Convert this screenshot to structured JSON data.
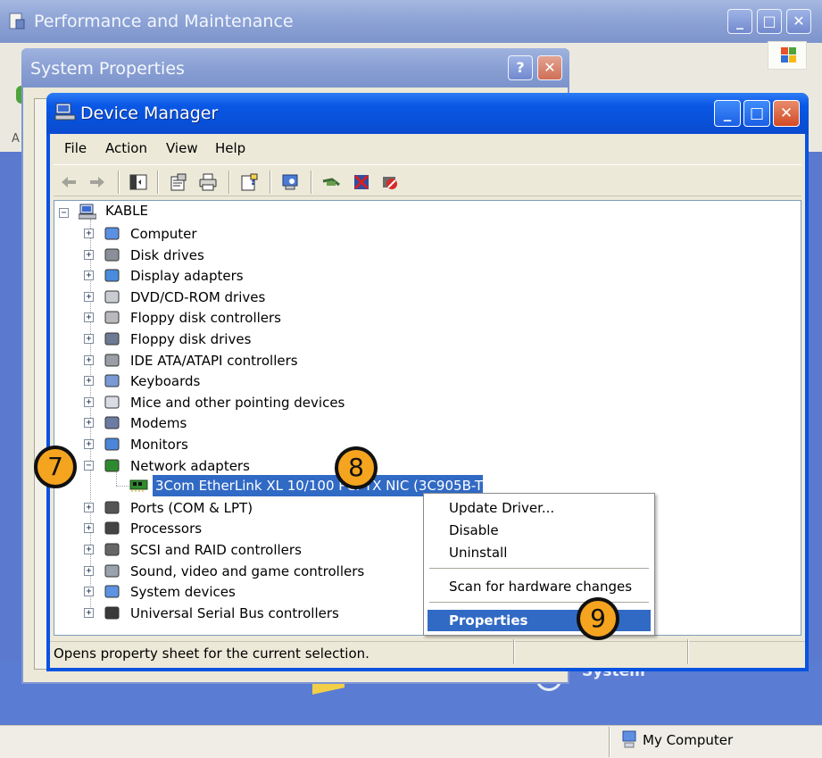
{
  "background_window": {
    "title": "Performance and Maintenance",
    "system_label": "System",
    "status_item": "My Computer",
    "menu_letter": "A"
  },
  "system_properties": {
    "title": "System Properties",
    "help_button": "?",
    "close_button": "✕"
  },
  "device_manager": {
    "title": "Device Manager",
    "menu": [
      "File",
      "Action",
      "View",
      "Help"
    ],
    "toolbar": [
      "back-icon",
      "forward-icon",
      "show-hide-console-tree-icon",
      "properties-icon",
      "print-icon",
      "help-icon",
      "scan-hardware-icon",
      "update-driver-icon",
      "uninstall-icon",
      "disable-icon"
    ],
    "tree": {
      "root": "KABLE",
      "categories": [
        {
          "label": "Computer",
          "expanded": false
        },
        {
          "label": "Disk drives",
          "expanded": false
        },
        {
          "label": "Display adapters",
          "expanded": false
        },
        {
          "label": "DVD/CD-ROM drives",
          "expanded": false
        },
        {
          "label": "Floppy disk controllers",
          "expanded": false
        },
        {
          "label": "Floppy disk drives",
          "expanded": false
        },
        {
          "label": "IDE ATA/ATAPI controllers",
          "expanded": false
        },
        {
          "label": "Keyboards",
          "expanded": false
        },
        {
          "label": "Mice and other pointing devices",
          "expanded": false
        },
        {
          "label": "Modems",
          "expanded": false
        },
        {
          "label": "Monitors",
          "expanded": false
        },
        {
          "label": "Network adapters",
          "expanded": true
        },
        {
          "label": "Ports (COM & LPT)",
          "expanded": false
        },
        {
          "label": "Processors",
          "expanded": false
        },
        {
          "label": "SCSI and RAID controllers",
          "expanded": false
        },
        {
          "label": "Sound, video and game controllers",
          "expanded": false
        },
        {
          "label": "System devices",
          "expanded": false
        },
        {
          "label": "Universal Serial Bus controllers",
          "expanded": false
        }
      ],
      "selected_device": "3Com EtherLink XL 10/100 PCI TX NIC (3C905B-TX)"
    },
    "status_text": "Opens property sheet for the current selection."
  },
  "context_menu": {
    "items": [
      "Update Driver...",
      "Disable",
      "Uninstall",
      "Scan for hardware changes",
      "Properties"
    ],
    "active_item": "Properties"
  },
  "callouts": [
    "7",
    "8",
    "9"
  ],
  "colors": {
    "xp_title_blue": "#0a58e6",
    "selection_blue": "#316ac5",
    "callout_orange": "#f5a41f",
    "inactive_title": "#8ea4d6"
  }
}
